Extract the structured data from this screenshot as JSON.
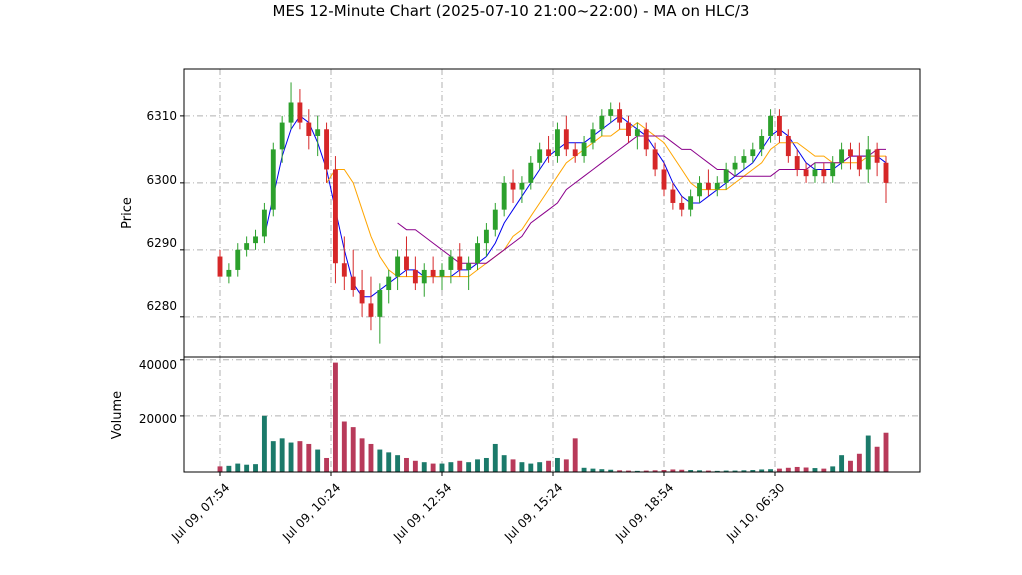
{
  "title": "MES 12-Minute Chart (2025-07-10 21:00~22:00) - MA on HLC/3",
  "price_axis_label": "Price",
  "volume_axis_label": "Volume",
  "x_tick_labels": [
    "Jul 09, 07:54",
    "Jul 09, 10:24",
    "Jul 09, 12:54",
    "Jul 09, 15:24",
    "Jul 09, 18:54",
    "Jul 10, 06:30"
  ],
  "price_tick_labels": [
    "6280",
    "6290",
    "6300",
    "6310"
  ],
  "volume_tick_labels": [
    "20000",
    "40000"
  ],
  "colors": {
    "up": "#2ca02c",
    "down": "#d62728",
    "ma_fast": "#0000ee",
    "ma_mid": "#ffa500",
    "ma_slow": "#8b008b",
    "vol_up": "#1b7a6a",
    "vol_down": "#b83a5a",
    "grid": "#b0b0b0"
  },
  "chart_data": {
    "type": "candlestick",
    "title": "MES 12-Minute Chart (2025-07-10 21:00~22:00) - MA on HLC/3",
    "ylabel": "Price",
    "volume_ylabel": "Volume",
    "price_ylim": [
      6274,
      6317
    ],
    "volume_ylim": [
      0,
      41000
    ],
    "grid": true,
    "x_ticks": [
      {
        "label": "Jul 09, 07:54",
        "bar": 0
      },
      {
        "label": "Jul 09, 10:24",
        "bar": 12.5
      },
      {
        "label": "Jul 09, 12:54",
        "bar": 25
      },
      {
        "label": "Jul 09, 15:24",
        "bar": 37.5
      },
      {
        "label": "Jul 09, 18:54",
        "bar": 50
      },
      {
        "label": "Jul 10, 06:30",
        "bar": 62.5
      }
    ],
    "bar_count": 76,
    "candles": [
      [
        6289,
        6290,
        6286,
        6286,
        2000
      ],
      [
        6286,
        6288,
        6285,
        6287,
        2200
      ],
      [
        6287,
        6291,
        6286,
        6290,
        3000
      ],
      [
        6290,
        6292,
        6289,
        6291,
        2600
      ],
      [
        6291,
        6293,
        6290,
        6292,
        2800
      ],
      [
        6292,
        6297,
        6291,
        6296,
        20000
      ],
      [
        6296,
        6306,
        6295,
        6305,
        11000
      ],
      [
        6305,
        6310,
        6303,
        6309,
        12000
      ],
      [
        6309,
        6315,
        6308,
        6312,
        10500
      ],
      [
        6312,
        6314,
        6308,
        6309,
        11000
      ],
      [
        6309,
        6311,
        6305,
        6307,
        10000
      ],
      [
        6307,
        6310,
        6304,
        6308,
        8000
      ],
      [
        6308,
        6309,
        6300,
        6302,
        5000
      ],
      [
        6302,
        6304,
        6285,
        6288,
        39000
      ],
      [
        6288,
        6292,
        6284,
        6286,
        18000
      ],
      [
        6286,
        6290,
        6283,
        6284,
        16000
      ],
      [
        6284,
        6287,
        6280,
        6282,
        12000
      ],
      [
        6282,
        6286,
        6278,
        6280,
        10000
      ],
      [
        6280,
        6285,
        6276,
        6284,
        8000
      ],
      [
        6284,
        6287,
        6282,
        6286,
        7000
      ],
      [
        6286,
        6290,
        6284,
        6289,
        6000
      ],
      [
        6289,
        6292,
        6286,
        6287,
        5000
      ],
      [
        6287,
        6289,
        6284,
        6285,
        4000
      ],
      [
        6285,
        6288,
        6283,
        6287,
        3500
      ],
      [
        6287,
        6289,
        6285,
        6286,
        3000
      ],
      [
        6286,
        6288,
        6284,
        6287,
        3000
      ],
      [
        6287,
        6290,
        6285,
        6289,
        3500
      ],
      [
        6289,
        6291,
        6286,
        6287,
        4000
      ],
      [
        6287,
        6289,
        6284,
        6288,
        3500
      ],
      [
        6288,
        6292,
        6287,
        6291,
        4500
      ],
      [
        6291,
        6294,
        6289,
        6293,
        5000
      ],
      [
        6293,
        6297,
        6292,
        6296,
        10000
      ],
      [
        6296,
        6301,
        6295,
        6300,
        6000
      ],
      [
        6300,
        6302,
        6297,
        6299,
        4500
      ],
      [
        6299,
        6301,
        6297,
        6300,
        3500
      ],
      [
        6300,
        6304,
        6299,
        6303,
        3000
      ],
      [
        6303,
        6306,
        6302,
        6305,
        3500
      ],
      [
        6305,
        6307,
        6303,
        6304,
        4000
      ],
      [
        6304,
        6309,
        6303,
        6308,
        5000
      ],
      [
        6308,
        6310,
        6304,
        6305,
        4500
      ],
      [
        6305,
        6306,
        6303,
        6304,
        12000
      ],
      [
        6304,
        6307,
        6303,
        6306,
        1500
      ],
      [
        6306,
        6309,
        6305,
        6308,
        1200
      ],
      [
        6308,
        6311,
        6307,
        6310,
        1000
      ],
      [
        6310,
        6312,
        6309,
        6311,
        800
      ],
      [
        6311,
        6312,
        6308,
        6309,
        600
      ],
      [
        6309,
        6310,
        6306,
        6307,
        500
      ],
      [
        6307,
        6309,
        6305,
        6308,
        400
      ],
      [
        6308,
        6309,
        6304,
        6305,
        500
      ],
      [
        6305,
        6306,
        6301,
        6302,
        600
      ],
      [
        6302,
        6303,
        6298,
        6299,
        700
      ],
      [
        6299,
        6300,
        6296,
        6297,
        900
      ],
      [
        6297,
        6298,
        6295,
        6296,
        800
      ],
      [
        6296,
        6299,
        6295,
        6298,
        700
      ],
      [
        6298,
        6301,
        6297,
        6300,
        600
      ],
      [
        6300,
        6302,
        6298,
        6299,
        500
      ],
      [
        6299,
        6301,
        6298,
        6300,
        400
      ],
      [
        6300,
        6303,
        6299,
        6302,
        500
      ],
      [
        6302,
        6304,
        6301,
        6303,
        500
      ],
      [
        6303,
        6305,
        6302,
        6304,
        600
      ],
      [
        6304,
        6306,
        6303,
        6305,
        700
      ],
      [
        6305,
        6308,
        6304,
        6307,
        900
      ],
      [
        6307,
        6311,
        6306,
        6310,
        1000
      ],
      [
        6310,
        6311,
        6306,
        6307,
        1200
      ],
      [
        6307,
        6308,
        6303,
        6304,
        1500
      ],
      [
        6304,
        6305,
        6301,
        6302,
        1800
      ],
      [
        6302,
        6303,
        6300,
        6301,
        1600
      ],
      [
        6301,
        6303,
        6300,
        6302,
        1400
      ],
      [
        6302,
        6303,
        6300,
        6301,
        1200
      ],
      [
        6301,
        6304,
        6300,
        6303,
        2000
      ],
      [
        6303,
        6306,
        6302,
        6305,
        6000
      ],
      [
        6305,
        6306,
        6302,
        6304,
        4000
      ],
      [
        6304,
        6306,
        6301,
        6302,
        6500
      ],
      [
        6302,
        6307,
        6300,
        6305,
        13000
      ],
      [
        6305,
        6306,
        6301,
        6303,
        9000
      ],
      [
        6303,
        6304,
        6297,
        6300,
        14000
      ]
    ],
    "ma_fast": [
      null,
      null,
      null,
      null,
      null,
      6292,
      6298,
      6304,
      6308,
      6310,
      6309,
      6306,
      6302,
      6296,
      6290,
      6285,
      6283,
      6283,
      6284,
      6285,
      6286,
      6287,
      6287,
      6286,
      6286,
      6286,
      6286,
      6287,
      6287,
      6288,
      6289,
      6291,
      6294,
      6296,
      6298,
      6300,
      6302,
      6304,
      6305,
      6306,
      6306,
      6306,
      6307,
      6308,
      6309,
      6310,
      6309,
      6308,
      6307,
      6305,
      6303,
      6300,
      6298,
      6297,
      6297,
      6298,
      6299,
      6300,
      6301,
      6302,
      6303,
      6305,
      6307,
      6308,
      6307,
      6305,
      6303,
      6302,
      6302,
      6302,
      6303,
      6304,
      6304,
      6304,
      6304,
      6303
    ],
    "ma_mid": [
      null,
      null,
      null,
      null,
      null,
      null,
      null,
      null,
      null,
      null,
      null,
      null,
      6300,
      6302,
      6302,
      6300,
      6296,
      6292,
      6289,
      6287,
      6286,
      6286,
      6286,
      6286,
      6286,
      6286,
      6286,
      6286,
      6286,
      6287,
      6288,
      6289,
      6290,
      6292,
      6293,
      6295,
      6297,
      6299,
      6301,
      6303,
      6304,
      6305,
      6306,
      6307,
      6307,
      6308,
      6308,
      6309,
      6308,
      6307,
      6306,
      6304,
      6302,
      6300,
      6299,
      6299,
      6299,
      6299,
      6300,
      6301,
      6302,
      6303,
      6305,
      6306,
      6306,
      6306,
      6305,
      6304,
      6304,
      6303,
      6303,
      6303,
      6303,
      6304,
      6304,
      6304
    ],
    "ma_slow": [
      null,
      null,
      null,
      null,
      null,
      null,
      null,
      null,
      null,
      null,
      null,
      null,
      null,
      null,
      null,
      null,
      null,
      null,
      null,
      null,
      6294,
      6293,
      6293,
      6292,
      6291,
      6290,
      6289,
      6288,
      6288,
      6288,
      6288,
      6289,
      6290,
      6291,
      6292,
      6294,
      6295,
      6296,
      6297,
      6299,
      6300,
      6301,
      6302,
      6303,
      6304,
      6305,
      6306,
      6307,
      6307,
      6307,
      6307,
      6306,
      6305,
      6305,
      6304,
      6303,
      6302,
      6302,
      6301,
      6301,
      6301,
      6301,
      6301,
      6302,
      6302,
      6302,
      6302,
      6303,
      6303,
      6303,
      6303,
      6304,
      6304,
      6304,
      6305,
      6305
    ]
  }
}
